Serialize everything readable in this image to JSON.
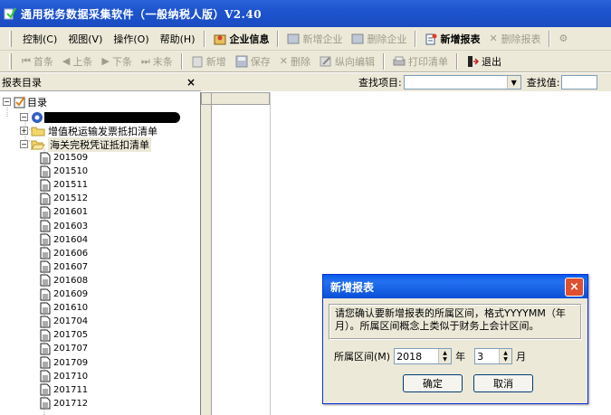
{
  "window": {
    "title": "通用税务数据采集软件（一般纳税人版）V2.40"
  },
  "menubar": {
    "menus": [
      "控制(C)",
      "视图(V)",
      "操作(O)",
      "帮助(H)"
    ],
    "buttons": {
      "company_info": "企业信息",
      "new_company": "新增企业",
      "delete_company": "删除企业",
      "new_report": "新增报表",
      "delete_report": "删除报表"
    }
  },
  "toolbar": {
    "first": "首条",
    "prev": "上条",
    "next": "下条",
    "last": "末条",
    "add": "新增",
    "save": "保存",
    "delete": "删除",
    "vertical_edit": "纵向编辑",
    "print_list": "打印清单",
    "exit": "退出"
  },
  "tree_panel": {
    "header": "报表目录",
    "close": "×",
    "root": "目录",
    "folders": [
      "增值税运输发票抵扣清单",
      "海关完税凭证抵扣清单"
    ],
    "periods": [
      "201509",
      "201510",
      "201511",
      "201512",
      "201601",
      "201603",
      "201604",
      "201606",
      "201607",
      "201608",
      "201609",
      "201610",
      "201704",
      "201705",
      "201707",
      "201709",
      "201710",
      "201711",
      "201712"
    ]
  },
  "search": {
    "item_label": "查找项目:",
    "value_label": "查找值:"
  },
  "dialog": {
    "title": "新增报表",
    "close": "×",
    "message_line1": "请您确认要新增报表的所属区间，格式YYYYMM（年",
    "message_line2": "月）。所属区间概念上类似于财务上会计区间。",
    "period_label": "所属区间(M)",
    "year_value": "2018",
    "year_unit": "年",
    "month_value": "3",
    "month_unit": "月",
    "ok": "确定",
    "cancel": "取消"
  }
}
